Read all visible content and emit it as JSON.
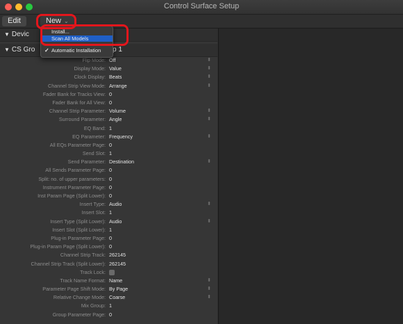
{
  "window": {
    "title": "Control Surface Setup"
  },
  "menubar": {
    "edit_label": "Edit",
    "new_label": "New",
    "new_chevron": "⌄"
  },
  "dropdown": {
    "items": [
      {
        "label": "Install..."
      },
      {
        "label": "Scan All Models"
      },
      {
        "label": "Automatic Installation",
        "checked": true,
        "check_glyph": "✓"
      }
    ]
  },
  "sections": [
    {
      "label": "Devic",
      "expander": "▼"
    },
    {
      "label": "CS Gro",
      "suffix": "p 1",
      "expander": "▼"
    }
  ],
  "params": [
    {
      "label": "Flip Mode:",
      "value": "Off",
      "popup": true
    },
    {
      "label": "Display Mode:",
      "value": "Value",
      "popup": true
    },
    {
      "label": "Clock Display:",
      "value": "Beats",
      "popup": true
    },
    {
      "label": "Channel Strip View Mode:",
      "value": "Arrange",
      "popup": true
    },
    {
      "label": "Fader Bank for Tracks View:",
      "value": "0",
      "popup": false
    },
    {
      "label": "Fader Bank for All View:",
      "value": "0",
      "popup": false
    },
    {
      "label": "Channel Strip Parameter:",
      "value": "Volume",
      "popup": true
    },
    {
      "label": "Surround Parameter:",
      "value": "Angle",
      "popup": true
    },
    {
      "label": "EQ Band:",
      "value": "1",
      "popup": false
    },
    {
      "label": "EQ Parameter:",
      "value": "Frequency",
      "popup": true
    },
    {
      "label": "All EQs Parameter Page:",
      "value": "0",
      "popup": false
    },
    {
      "label": "Send Slot:",
      "value": "1",
      "popup": false
    },
    {
      "label": "Send Parameter:",
      "value": "Destination",
      "popup": true
    },
    {
      "label": "All Sends Parameter Page:",
      "value": "0",
      "popup": false
    },
    {
      "label": "Split: no. of upper parameters:",
      "value": "0",
      "popup": false
    },
    {
      "label": "Instrument Parameter Page:",
      "value": "0",
      "popup": false
    },
    {
      "label": "Inst Param Page (Split Lower):",
      "value": "0",
      "popup": false
    },
    {
      "label": "Insert Type:",
      "value": "Audio",
      "popup": true
    },
    {
      "label": "Insert Slot:",
      "value": "1",
      "popup": false
    },
    {
      "label": "Insert Type (Split Lower):",
      "value": "Audio",
      "popup": true
    },
    {
      "label": "Insert Slot (Split Lower):",
      "value": "1",
      "popup": false
    },
    {
      "label": "Plug-in Parameter Page:",
      "value": "0",
      "popup": false
    },
    {
      "label": "Plug-in Param Page (Split Lower):",
      "value": "0",
      "popup": false
    },
    {
      "label": "Channel Strip Track:",
      "value": "262145",
      "popup": false
    },
    {
      "label": "Channel Strip Track (Split Lower):",
      "value": "262145",
      "popup": false
    },
    {
      "label": "Track Lock:",
      "value": "",
      "checkbox": true,
      "popup": false
    },
    {
      "label": "Track Name Format:",
      "value": "Name",
      "popup": true
    },
    {
      "label": "Parameter Page Shift Mode:",
      "value": "By Page",
      "popup": true
    },
    {
      "label": "Relative Change Mode:",
      "value": "Coarse",
      "popup": true
    },
    {
      "label": "Mix Group:",
      "value": "1",
      "popup": false
    },
    {
      "label": "Group Parameter Page:",
      "value": "0",
      "popup": false
    }
  ],
  "popup_glyph": "⬍",
  "colors": {
    "highlight": "#e3161c",
    "menu_selection": "#1f5fc7"
  }
}
